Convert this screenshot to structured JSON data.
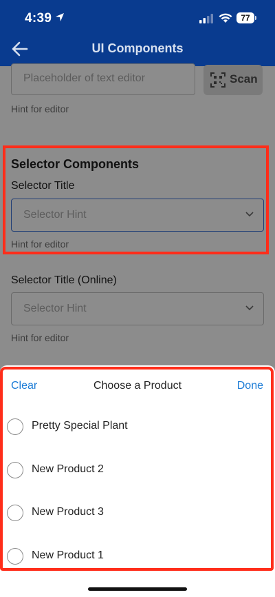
{
  "status_bar": {
    "time": "4:39",
    "battery": "77"
  },
  "header": {
    "title": "UI Components"
  },
  "text_editor": {
    "placeholder": "Placeholder of text editor",
    "scan_label": "Scan",
    "hint": "Hint for editor"
  },
  "selector_section": {
    "title": "Selector Components",
    "selector": {
      "title": "Selector Title",
      "hint_text": "Selector Hint",
      "hint": "Hint for editor"
    }
  },
  "online_selector": {
    "title": "Selector Title (Online)",
    "hint_text": "Selector Hint",
    "hint": "Hint for editor"
  },
  "sheet": {
    "clear_label": "Clear",
    "title": "Choose a Product",
    "done_label": "Done",
    "options": [
      {
        "label": "Pretty Special Plant"
      },
      {
        "label": "New Product 2"
      },
      {
        "label": "New Product 3"
      },
      {
        "label": "New Product 1"
      }
    ]
  },
  "colors": {
    "header_bg": "#093b8f",
    "link": "#1a7bd6",
    "highlight": "#ff2d1a"
  }
}
